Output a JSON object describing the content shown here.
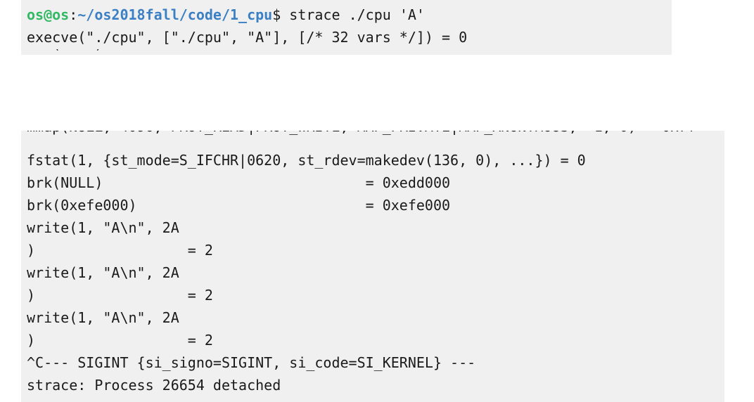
{
  "terminal_top": {
    "prompt_user": "os@os",
    "prompt_sep": ":",
    "prompt_path": "~/os2018fall/code/1_cpu",
    "prompt_dollar": "$",
    "command": " strace ./cpu 'A'",
    "line_execve": "execve(\"./cpu\", [\"./cpu\", \"A\"], [/* 32 vars */]) = 0"
  },
  "terminal_bottom": {
    "lines": [
      "fstat(1, {st_mode=S_IFCHR|0620, st_rdev=makedev(136, 0), ...}) = 0",
      "brk(NULL)                               = 0xedd000",
      "brk(0xefe000)                           = 0xefe000",
      "write(1, \"A\\n\", 2A",
      ")                  = 2",
      "write(1, \"A\\n\", 2A",
      ")                  = 2",
      "write(1, \"A\\n\", 2A",
      ")                  = 2",
      "^C--- SIGINT {si_signo=SIGINT, si_code=SI_KERNEL} ---",
      "strace: Process 26654 detached"
    ]
  },
  "colors": {
    "terminal_bg": "#f0f0f0",
    "prompt_user": "#33b864",
    "prompt_path": "#3b7fc4",
    "text": "#1a1a1a"
  }
}
